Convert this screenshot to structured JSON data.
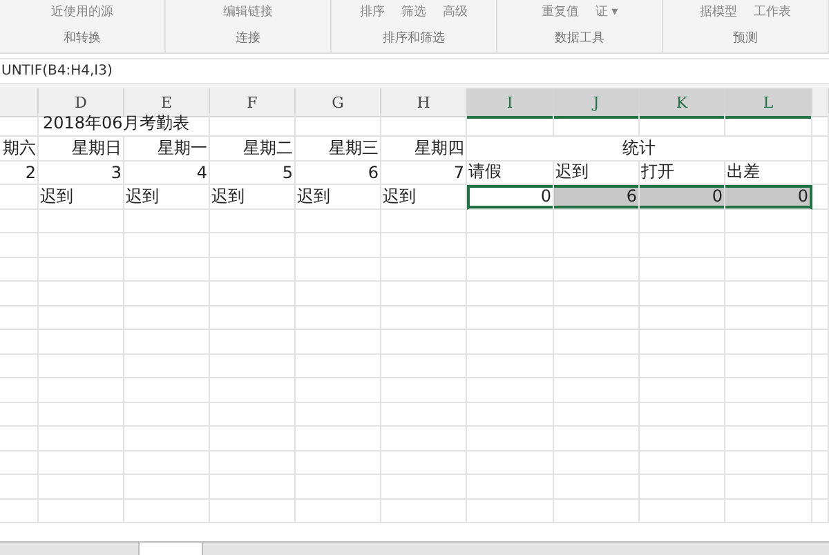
{
  "ribbon": {
    "groups": [
      {
        "items": [
          "近使用的源"
        ],
        "label": "和转换"
      },
      {
        "items": [
          "编辑链接"
        ],
        "label": "连接"
      },
      {
        "items": [
          "排序",
          "筛选",
          "高级"
        ],
        "label": "排序和筛选"
      },
      {
        "items": [
          "重复值",
          "证 ▾"
        ],
        "label": "数据工具"
      },
      {
        "items": [
          "据模型",
          "工作表"
        ],
        "label": "预测"
      }
    ]
  },
  "formula_bar": {
    "value": "UNTIF(B4:H4,I3)"
  },
  "columns": [
    {
      "selected": false
    },
    {
      "label": "D",
      "selected": false
    },
    {
      "label": "E",
      "selected": false
    },
    {
      "label": "F",
      "selected": false
    },
    {
      "label": "G",
      "selected": false
    },
    {
      "label": "H",
      "selected": false
    },
    {
      "label": "I",
      "selected": true
    },
    {
      "label": "J",
      "selected": true
    },
    {
      "label": "K",
      "selected": true
    },
    {
      "label": "L",
      "selected": true
    },
    {
      "selected": false
    }
  ],
  "rows": [
    {
      "cells": [
        {
          "kind": "empty"
        },
        {
          "kind": "title",
          "text": "2018年06月考勤表"
        }
      ]
    },
    {
      "cells": [
        {
          "kind": "number",
          "text": "期六"
        },
        {
          "kind": "number",
          "text": "星期日"
        },
        {
          "kind": "number",
          "text": "星期一"
        },
        {
          "kind": "number",
          "text": "星期二"
        },
        {
          "kind": "number",
          "text": "星期三"
        },
        {
          "kind": "number",
          "text": "星期四"
        },
        {
          "kind": "merged",
          "text": "统计"
        }
      ]
    },
    {
      "cells": [
        {
          "kind": "number",
          "text": "2"
        },
        {
          "kind": "number",
          "text": "3"
        },
        {
          "kind": "number",
          "text": "4"
        },
        {
          "kind": "number",
          "text": "5"
        },
        {
          "kind": "number",
          "text": "6"
        },
        {
          "kind": "number",
          "text": "7"
        },
        {
          "kind": "text",
          "text": "请假"
        },
        {
          "kind": "text",
          "text": "迟到"
        },
        {
          "kind": "text",
          "text": "打开"
        },
        {
          "kind": "text",
          "text": "出差"
        }
      ]
    },
    {
      "cells": [
        {
          "kind": "empty"
        },
        {
          "kind": "text",
          "text": "迟到"
        },
        {
          "kind": "text",
          "text": "迟到"
        },
        {
          "kind": "text",
          "text": "迟到"
        },
        {
          "kind": "text",
          "text": "迟到"
        },
        {
          "kind": "text",
          "text": "迟到"
        },
        {
          "kind": "number",
          "text": "0",
          "selected": true,
          "active": true
        },
        {
          "kind": "number",
          "text": "6",
          "selected": true,
          "active": false
        },
        {
          "kind": "number",
          "text": "0",
          "selected": true,
          "active": false
        },
        {
          "kind": "number",
          "text": "0",
          "selected": true,
          "active": false
        }
      ]
    }
  ]
}
